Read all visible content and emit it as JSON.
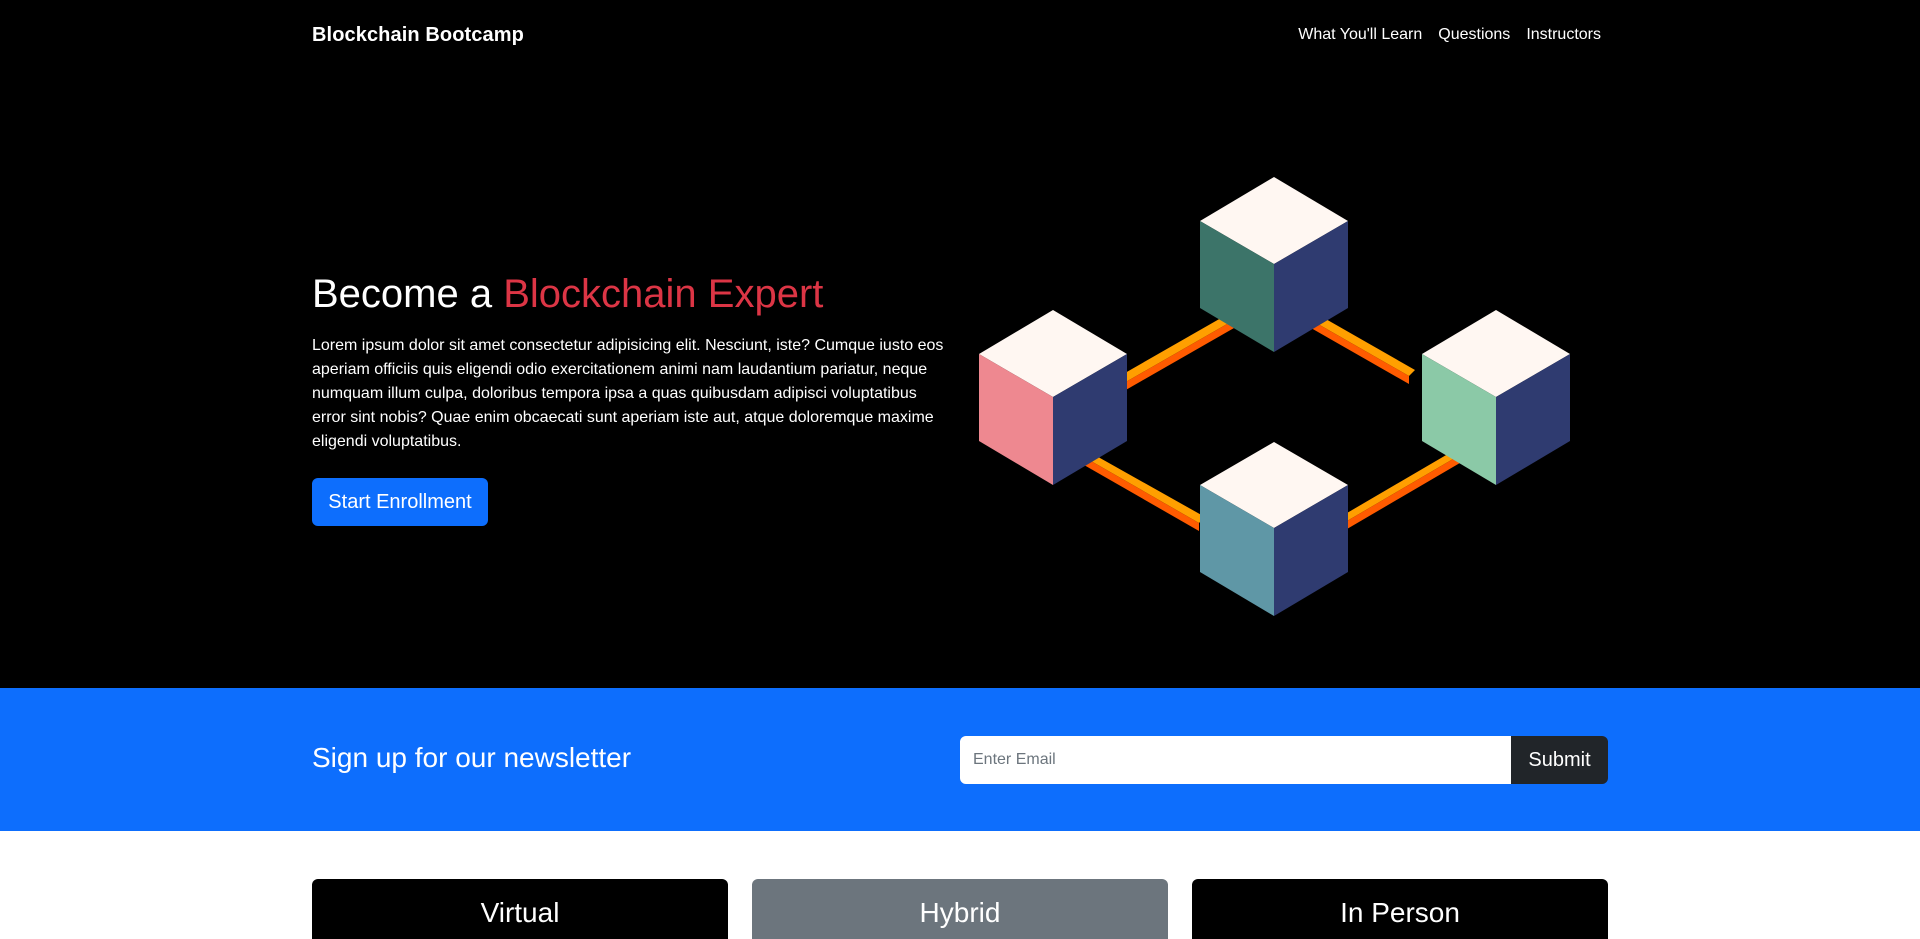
{
  "navbar": {
    "brand": "Blockchain Bootcamp",
    "links": [
      "What You'll Learn",
      "Questions",
      "Instructors"
    ]
  },
  "hero": {
    "title_prefix": "Become a ",
    "title_accent": "Blockchain Expert",
    "text": "Lorem ipsum dolor sit amet consectetur adipisicing elit. Nesciunt, iste? Cumque iusto eos aperiam officiis quis eligendi odio exercitationem animi nam laudantium pariatur, neque numquam illum culpa, doloribus tempora ipsa a quas quibusdam adipisci voluptatibus error sint nobis? Quae enim obcaecati sunt aperiam iste aut, atque doloremque maxime eligendi voluptatibus.",
    "button": "Start Enrollment",
    "illustration": "blockchain-cubes-illustration"
  },
  "newsletter": {
    "title": "Sign up for our newsletter",
    "email_placeholder": "Enter Email",
    "email_value": "",
    "submit": "Submit"
  },
  "cards": [
    {
      "title": "Virtual"
    },
    {
      "title": "Hybrid"
    },
    {
      "title": "In Person"
    }
  ],
  "colors": {
    "primary": "#0d6efd",
    "danger": "#dc3545",
    "dark": "#212529",
    "secondary": "#6c757d",
    "bar_orange": "#ff9f00",
    "bar_red": "#ff5b00"
  }
}
